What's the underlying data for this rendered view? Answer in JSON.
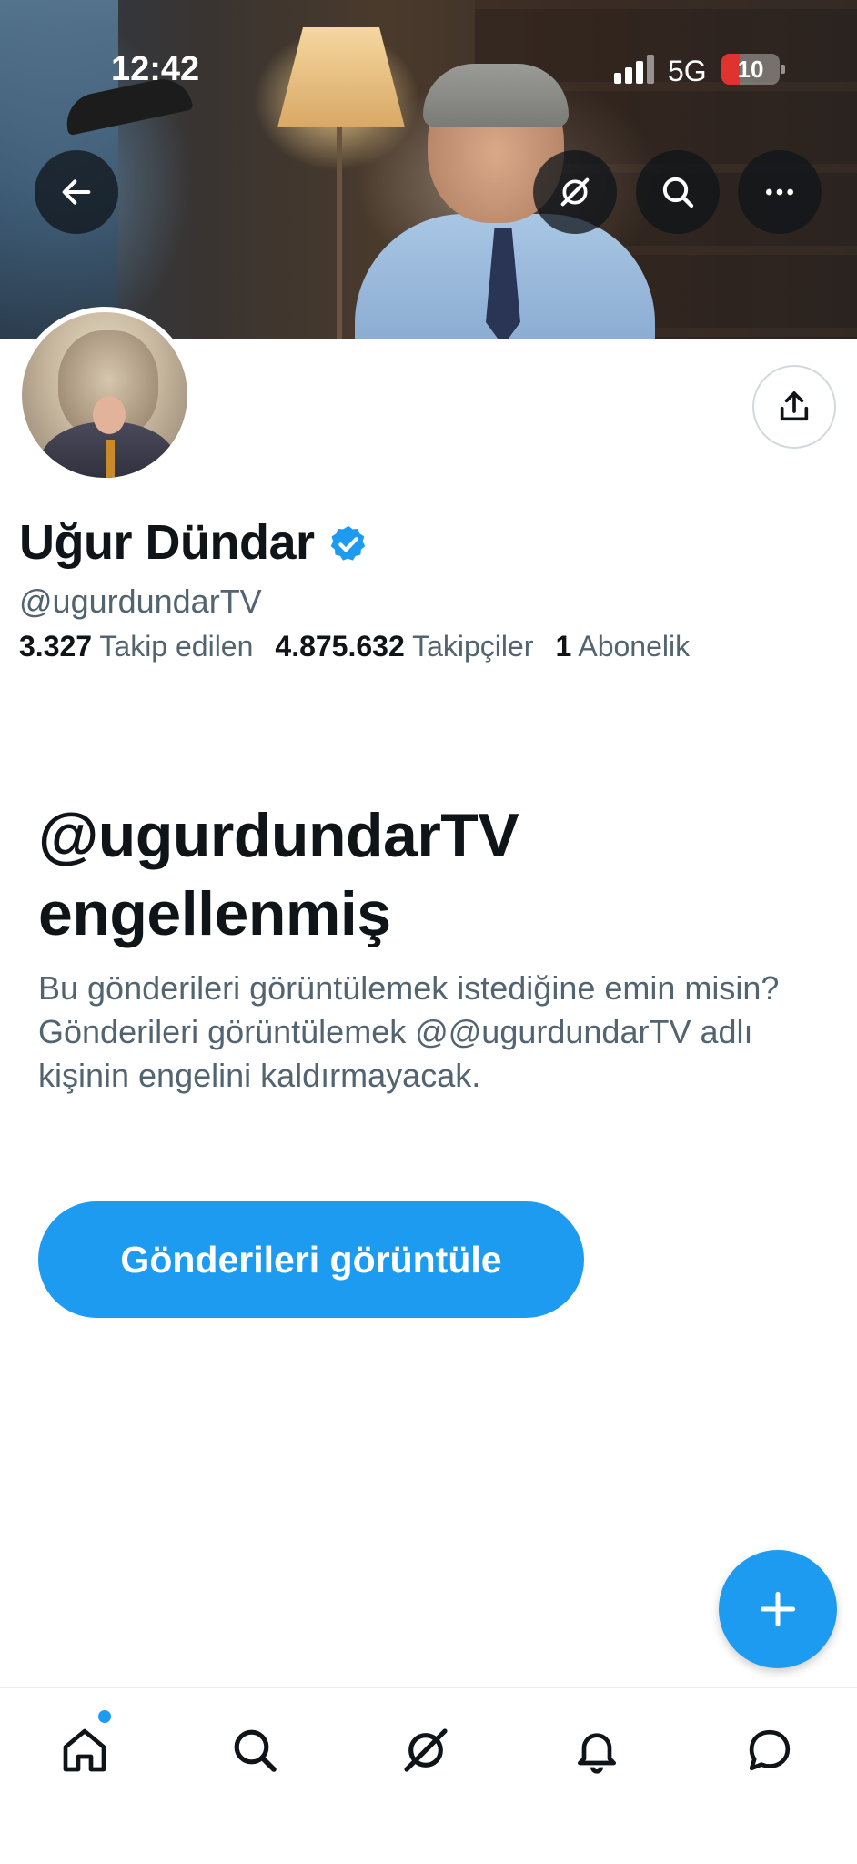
{
  "status_bar": {
    "time": "12:42",
    "network": "5G",
    "battery_level": "10",
    "battery_color": "#e0322e"
  },
  "header": {
    "back_icon": "arrow-left-icon",
    "grok_icon": "grok-icon",
    "search_icon": "search-icon",
    "more_icon": "more-horizontal-icon"
  },
  "profile": {
    "name": "Uğur Dündar",
    "handle": "@ugurdundarTV",
    "verified": true,
    "verified_color": "#1d9bf0",
    "stats": {
      "following_count": "3.327",
      "following_label": "Takip edilen",
      "followers_count": "4.875.632",
      "followers_label": "Takipçiler",
      "subscriptions_count": "1",
      "subscriptions_label": "Abonelik"
    },
    "share_icon": "share-icon"
  },
  "blocked": {
    "title_line1": "@ugurdundarTV",
    "title_line2": "engellenmiş",
    "description": "Bu gönderileri görüntülemek istediğine emin misin? Gönderileri görüntülemek @@ugurdundarTV adlı kişinin engelini kaldırmayacak.",
    "button_label": "Gönderileri görüntüle"
  },
  "fab": {
    "icon": "plus-icon"
  },
  "bottom_nav": {
    "items": [
      {
        "name": "home",
        "icon": "home-icon",
        "has_notification_dot": true
      },
      {
        "name": "search",
        "icon": "search-icon"
      },
      {
        "name": "grok",
        "icon": "grok-icon"
      },
      {
        "name": "notifications",
        "icon": "bell-icon"
      },
      {
        "name": "messages",
        "icon": "message-icon"
      }
    ]
  },
  "colors": {
    "accent": "#1d9bf0",
    "text_primary": "#0f1419",
    "text_secondary": "#536471"
  }
}
